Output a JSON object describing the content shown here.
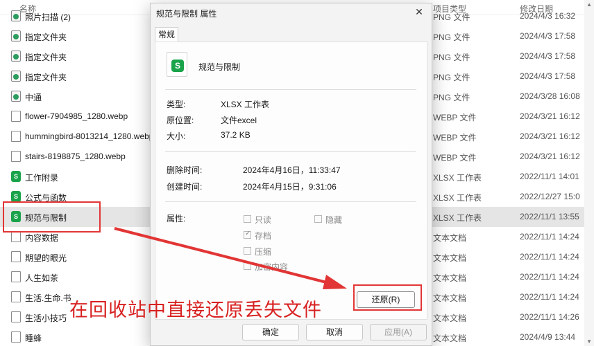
{
  "explorer": {
    "columns": {
      "name": "名称",
      "type": "项目类型",
      "date": "修改日期"
    },
    "rows": [
      {
        "name": "照片扫描 (2)",
        "type": "PNG 文件",
        "date": "2024/4/3 16:32",
        "icon": "png-file-icon"
      },
      {
        "name": "指定文件夹",
        "type": "PNG 文件",
        "date": "2024/4/3 17:58",
        "icon": "png-file-icon"
      },
      {
        "name": "指定文件夹",
        "type": "PNG 文件",
        "date": "2024/4/3 17:58",
        "icon": "png-file-icon"
      },
      {
        "name": "指定文件夹",
        "type": "PNG 文件",
        "date": "2024/4/3 17:58",
        "icon": "png-file-icon"
      },
      {
        "name": "中通",
        "type": "PNG 文件",
        "date": "2024/3/28 16:08",
        "icon": "png-file-icon"
      },
      {
        "name": "flower-7904985_1280.webp",
        "type": "WEBP 文件",
        "date": "2024/3/21 16:12",
        "icon": "document-icon"
      },
      {
        "name": "hummingbird-8013214_1280.webp",
        "type": "WEBP 文件",
        "date": "2024/3/21 16:12",
        "icon": "document-icon"
      },
      {
        "name": "stairs-8198875_1280.webp",
        "type": "WEBP 文件",
        "date": "2024/3/21 16:12",
        "icon": "document-icon"
      },
      {
        "name": "工作附录",
        "type": "XLSX 工作表",
        "date": "2022/11/1 14:01",
        "icon": "xlsx-file-icon"
      },
      {
        "name": "公式与函数",
        "type": "XLSX 工作表",
        "date": "2022/12/27 15:0",
        "icon": "xlsx-file-icon"
      },
      {
        "name": "规范与限制",
        "type": "XLSX 工作表",
        "date": "2022/11/1 13:55",
        "icon": "xlsx-file-icon"
      },
      {
        "name": "内容数据",
        "type": "文本文档",
        "date": "2022/11/1 14:24",
        "icon": "document-icon"
      },
      {
        "name": "期望的眼光",
        "type": "文本文档",
        "date": "2022/11/1 14:24",
        "icon": "document-icon"
      },
      {
        "name": "人生如茶",
        "type": "文本文档",
        "date": "2022/11/1 14:24",
        "icon": "document-icon"
      },
      {
        "name": "生活.生命.书",
        "type": "文本文档",
        "date": "2022/11/1 14:24",
        "icon": "document-icon"
      },
      {
        "name": "生活小技巧",
        "type": "文本文档",
        "date": "2022/11/1 14:26",
        "icon": "document-icon"
      },
      {
        "name": "睡蜂",
        "type": "文本文档",
        "date": "2024/4/9 13:44",
        "icon": "document-icon"
      }
    ],
    "selected_index": 10
  },
  "dialog": {
    "title": "规范与限制 属性",
    "close_glyph": "✕",
    "tab": "常规",
    "file_name": "规范与限制",
    "icon_letter": "S",
    "type_label": "类型:",
    "type_value": "XLSX 工作表",
    "location_label": "原位置:",
    "location_value": "文件excel",
    "size_label": "大小:",
    "size_value": "37.2 KB",
    "deleted_label": "删除时间:",
    "deleted_value": "2024年4月16日，11:33:47",
    "created_label": "创建时间:",
    "created_value": "2024年4月15日，9:31:06",
    "attributes_label": "属性:",
    "attributes": {
      "readonly": {
        "label": "只读",
        "checked": false
      },
      "hidden": {
        "label": "隐藏",
        "checked": false
      },
      "archive": {
        "label": "存档",
        "checked": true
      },
      "compress": {
        "label": "压缩",
        "checked": false
      },
      "encrypt": {
        "label": "加密内容",
        "checked": false
      }
    },
    "restore_button": "还原(R)",
    "ok_button": "确定",
    "cancel_button": "取消",
    "apply_button": "应用(A)"
  },
  "annotation": {
    "caption": "在回收站中直接还原丢失文件",
    "color": "#e23535"
  }
}
